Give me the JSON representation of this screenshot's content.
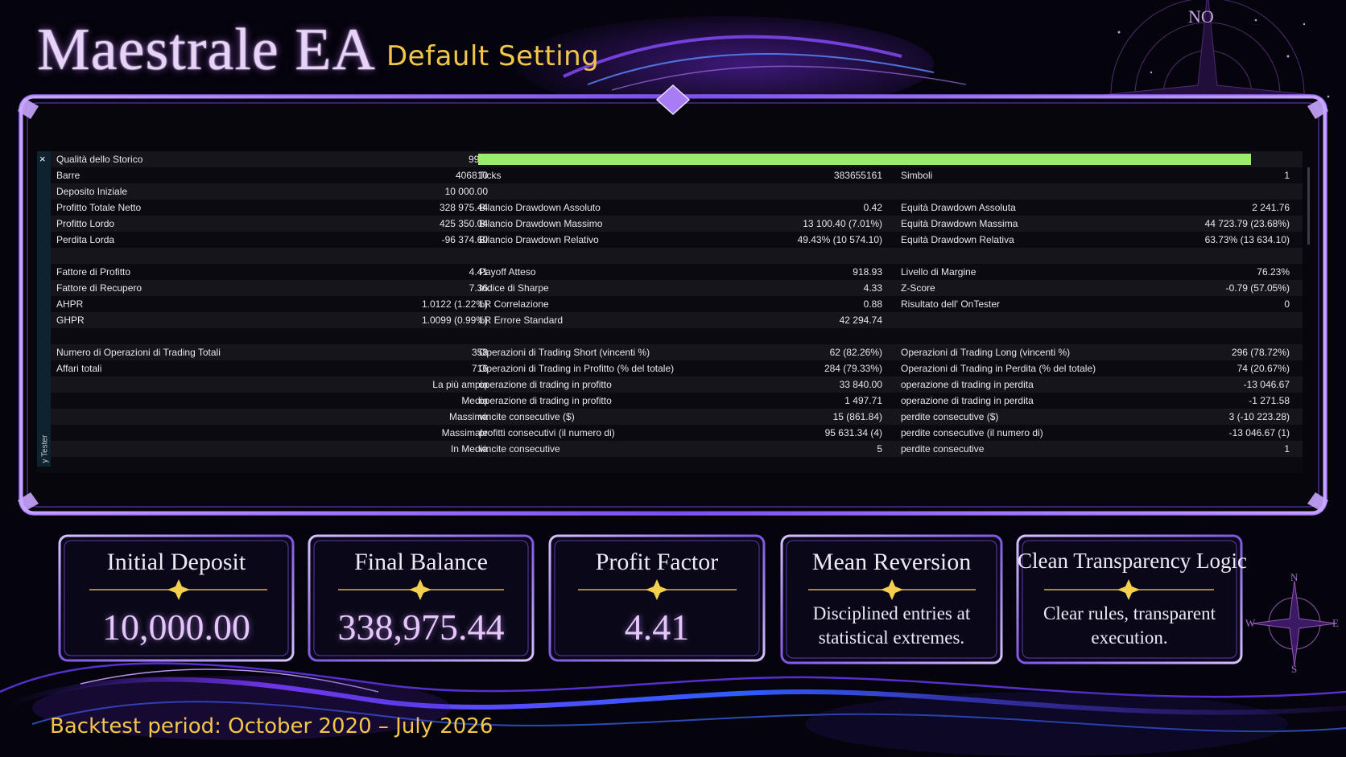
{
  "header": {
    "title": "Maestrale EA",
    "subtitle": "Default Setting",
    "compass_label": "NO"
  },
  "mini_compass": {
    "n": "N",
    "e": "E",
    "s": "S",
    "w": "W"
  },
  "panel": {
    "close_symbol": "×",
    "side_tab_label": "y Tester",
    "history_quality": {
      "label": "Qualità dello Storico",
      "value": "99%",
      "fill_fraction": 0.99
    },
    "rows": [
      {
        "l1": "Barre",
        "v1": "406810",
        "l2": "Ticks",
        "v2": "383655161",
        "l3": "Simboli",
        "v3": "1"
      },
      {
        "l1": "Deposito Iniziale",
        "v1": "10 000.00",
        "l2": "",
        "v2": "",
        "l3": "",
        "v3": ""
      },
      {
        "l1": "Profitto Totale Netto",
        "v1": "328 975.44",
        "l2": "Bilancio Drawdown Assoluto",
        "v2": "0.42",
        "l3": "Equità Drawdown Assoluta",
        "v3": "2 241.76"
      },
      {
        "l1": "Profitto Lordo",
        "v1": "425 350.04",
        "l2": "Bilancio Drawdown Massimo",
        "v2": "13 100.40 (7.01%)",
        "l3": "Equità Drawdown Massima",
        "v3": "44 723.79 (23.68%)"
      },
      {
        "l1": "Perdita Lorda",
        "v1": "-96 374.60",
        "l2": "Bilancio Drawdown Relativo",
        "v2": "49.43% (10 574.10)",
        "l3": "Equità Drawdown Relativa",
        "v3": "63.73% (13 634.10)"
      },
      {
        "l1": "",
        "v1": "",
        "l2": "",
        "v2": "",
        "l3": "",
        "v3": ""
      },
      {
        "l1": "Fattore di Profitto",
        "v1": "4.41",
        "l2": "Payoff Atteso",
        "v2": "918.93",
        "l3": "Livello di Margine",
        "v3": "76.23%"
      },
      {
        "l1": "Fattore di Recupero",
        "v1": "7.36",
        "l2": "Indice di Sharpe",
        "v2": "4.33",
        "l3": "Z-Score",
        "v3": "-0.79 (57.05%)"
      },
      {
        "l1": "AHPR",
        "v1": "1.0122 (1.22%)",
        "l2": "LR Correlazione",
        "v2": "0.88",
        "l3": "Risultato dell' OnTester",
        "v3": "0"
      },
      {
        "l1": "GHPR",
        "v1": "1.0099 (0.99%)",
        "l2": "LR Errore Standard",
        "v2": "42 294.74",
        "l3": "",
        "v3": ""
      },
      {
        "l1": "",
        "v1": "",
        "l2": "",
        "v2": "",
        "l3": "",
        "v3": ""
      },
      {
        "l1": "Numero di Operazioni di Trading Totali",
        "v1": "358",
        "l2": "Operazioni di Trading Short (vincenti %)",
        "v2": "62 (82.26%)",
        "l3": "Operazioni di Trading Long (vincenti %)",
        "v3": "296 (78.72%)"
      },
      {
        "l1": "Affari totali",
        "v1": "716",
        "l2": "Operazioni di Trading in Profitto (% del totale)",
        "v2": "284 (79.33%)",
        "l3": "Operazioni di Trading in Perdita (% del totale)",
        "v3": "74 (20.67%)"
      },
      {
        "l1": "",
        "v1": "La più ampia",
        "l2": "operazione di trading in profitto",
        "v2": "33 840.00",
        "l3": "operazione di trading in perdita",
        "v3": "-13 046.67"
      },
      {
        "l1": "",
        "v1": "Media",
        "l2": "operazione di trading in profitto",
        "v2": "1 497.71",
        "l3": "operazione di trading in perdita",
        "v3": "-1 271.58"
      },
      {
        "l1": "",
        "v1": "Massima",
        "l2": "vincite consecutive ($)",
        "v2": "15 (861.84)",
        "l3": "perdite consecutive ($)",
        "v3": "3 (-10 223.28)"
      },
      {
        "l1": "",
        "v1": "Massimale",
        "l2": "profitti consecutivi (il numero di)",
        "v2": "95 631.34 (4)",
        "l3": "perdite consecutive (il numero di)",
        "v3": "-13 046.67 (1)"
      },
      {
        "l1": "",
        "v1": "In Media",
        "l2": "vincite consecutive",
        "v2": "5",
        "l3": "perdite consecutive",
        "v3": "1"
      },
      {
        "l1": "",
        "v1": "",
        "l2": "",
        "v2": "",
        "l3": "",
        "v3": ""
      }
    ]
  },
  "cards": [
    {
      "title": "Initial Deposit",
      "value": "10,000.00"
    },
    {
      "title": "Final Balance",
      "value": "338,975.44"
    },
    {
      "title": "Profit Factor",
      "value": "4.41"
    },
    {
      "title": "Mean Reversion",
      "text": "Disciplined entries at statistical extremes."
    },
    {
      "title": "Clean Transparency Logic",
      "text": "Clear rules, transparent execution."
    }
  ],
  "footer": {
    "backtest_period": "Backtest period: October 2020 – July 2026"
  },
  "colors": {
    "background": "#05030c",
    "frame_purple": "#8c5cf0",
    "gold_accent": "#f3c64a",
    "quality_bar": "#98ee6c"
  }
}
